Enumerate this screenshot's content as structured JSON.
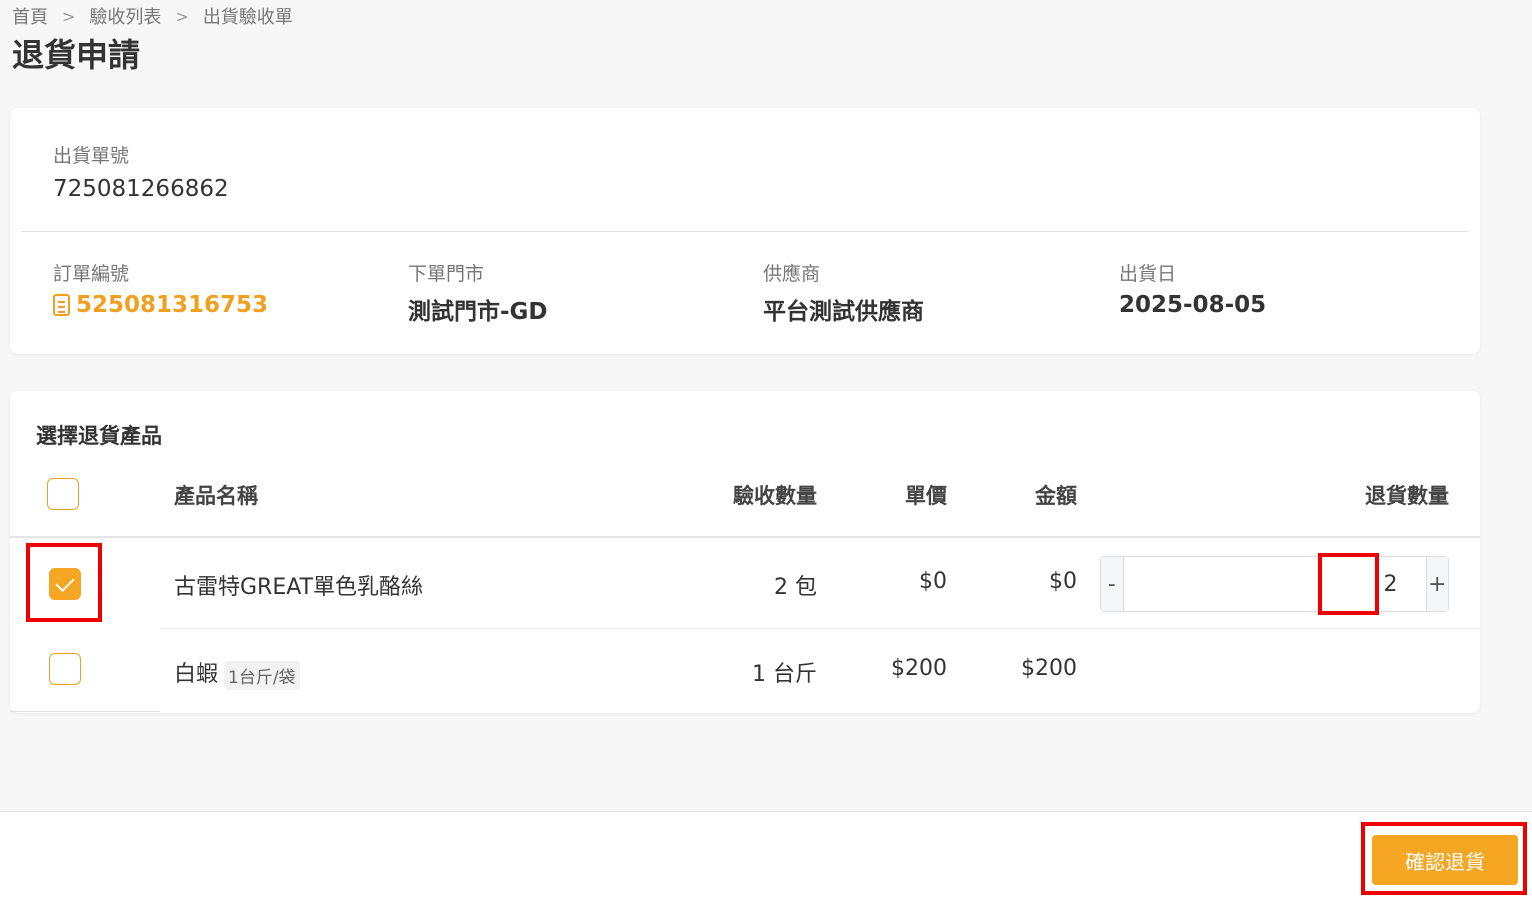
{
  "breadcrumb": [
    "首頁",
    "驗收列表",
    "出貨驗收單"
  ],
  "page_title": "退貨申請",
  "shipment": {
    "number_label": "出貨單號",
    "number": "725081266862",
    "order_label": "訂單編號",
    "order_number": "525081316753",
    "store_label": "下單門市",
    "store": "測試門市-GD",
    "supplier_label": "供應商",
    "supplier": "平台測試供應商",
    "date_label": "出貨日",
    "date": "2025-08-05"
  },
  "table": {
    "title": "選擇退貨產品",
    "headers": {
      "name": "產品名稱",
      "received_qty": "驗收數量",
      "unit_price": "單價",
      "amount": "金額",
      "return_qty": "退貨數量"
    },
    "rows": [
      {
        "checked": true,
        "name": "古雷特GREAT單色乳酪絲",
        "spec": "",
        "received_qty": "2 包",
        "unit_price": "$0",
        "amount": "$0",
        "return_qty": "2"
      },
      {
        "checked": false,
        "name": "白蝦",
        "spec": "1台斤/袋",
        "received_qty": "1 台斤",
        "unit_price": "$200",
        "amount": "$200",
        "return_qty": ""
      }
    ],
    "stepper": {
      "minus": "-",
      "plus": "+"
    }
  },
  "footer": {
    "confirm_label": "確認退貨"
  },
  "colors": {
    "accent": "#f5a623",
    "highlight": "#e00000"
  }
}
